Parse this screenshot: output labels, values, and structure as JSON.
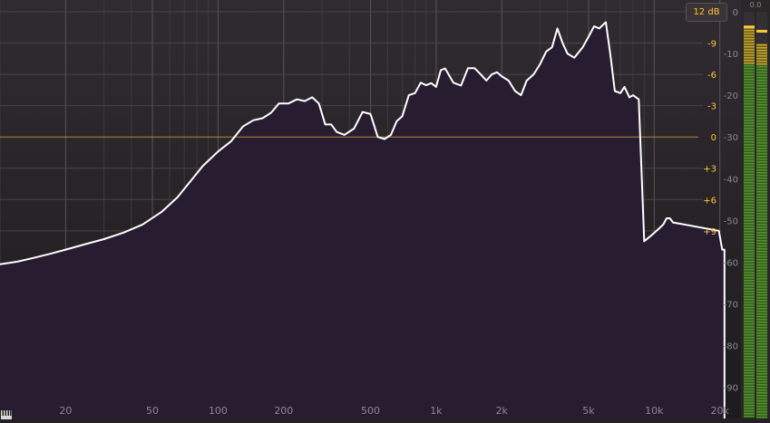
{
  "range_button": {
    "label": "12 dB"
  },
  "meter": {
    "peak_readout": "0.0",
    "left_level_db": -3.5,
    "right_level_db": -7.5,
    "left_peak_db": -3.2,
    "right_peak_db": -4.2
  },
  "colors": {
    "background": "#2a262a",
    "fill_top": "#6a2c86",
    "fill_bottom": "#281c30",
    "curve": "#ffffff",
    "zero_line": "#c8a03c",
    "eq_label": "#ffc53b",
    "db_label": "#8c8a8c",
    "meter_green": "#4c9a20",
    "meter_yellow": "#c8a81e",
    "meter_peak": "#ffc53b"
  },
  "chart_data": {
    "type": "area",
    "title": "",
    "xlabel": "",
    "ylabel": "",
    "x_scale": "log",
    "xlim": [
      10,
      25000
    ],
    "ylim": [
      -94,
      0
    ],
    "grid": true,
    "freq_labels": [
      {
        "f": 20,
        "label": "20"
      },
      {
        "f": 50,
        "label": "50"
      },
      {
        "f": 100,
        "label": "100"
      },
      {
        "f": 200,
        "label": "200"
      },
      {
        "f": 500,
        "label": "500"
      },
      {
        "f": 1000,
        "label": "1k"
      },
      {
        "f": 2000,
        "label": "2k"
      },
      {
        "f": 5000,
        "label": "5k"
      },
      {
        "f": 10000,
        "label": "10k"
      },
      {
        "f": 20000,
        "label": "20k"
      }
    ],
    "db_labels": [
      {
        "db": 0,
        "label": "0"
      },
      {
        "db": -10,
        "label": "-10"
      },
      {
        "db": -20,
        "label": "-20"
      },
      {
        "db": -30,
        "label": "-30"
      },
      {
        "db": -40,
        "label": "-40"
      },
      {
        "db": -50,
        "label": "-50"
      },
      {
        "db": -60,
        "label": "-60"
      },
      {
        "db": -70,
        "label": "-70"
      },
      {
        "db": -80,
        "label": "-80"
      },
      {
        "db": -90,
        "label": "-90"
      }
    ],
    "eq_scale": {
      "range_db": 12,
      "labels": [
        {
          "db": 9,
          "label": "+9"
        },
        {
          "db": 6,
          "label": "+6"
        },
        {
          "db": 3,
          "label": "+3"
        },
        {
          "db": 0,
          "label": "0"
        },
        {
          "db": -3,
          "label": "-3"
        },
        {
          "db": -6,
          "label": "-6"
        },
        {
          "db": -9,
          "label": "-9"
        },
        {
          "db": -12,
          "label": "-12"
        }
      ]
    },
    "series": [
      {
        "x": [
          10,
          12,
          14,
          17,
          20,
          25,
          30,
          37,
          45,
          55,
          65,
          75,
          85,
          100,
          115,
          130,
          145,
          160,
          175,
          190,
          210,
          230,
          250,
          270,
          290,
          310,
          330,
          350,
          380,
          420,
          460,
          500,
          540,
          580,
          620,
          660,
          700,
          750,
          800,
          850,
          900,
          950,
          1000,
          1050,
          1100,
          1200,
          1300,
          1400,
          1500,
          1600,
          1700,
          1800,
          1900,
          2000,
          2150,
          2300,
          2450,
          2600,
          2800,
          3000,
          3200,
          3400,
          3600,
          3800,
          4000,
          4300,
          4700,
          5000,
          5300,
          5600,
          6000,
          6300,
          6600,
          7000,
          7300,
          7700,
          8000,
          8500,
          9000,
          9500,
          10000,
          10500,
          11000,
          11400,
          11800,
          12200,
          19800,
          20500,
          21000
        ],
        "y": [
          -60.5,
          -59.9,
          -59.1,
          -58.0,
          -57.0,
          -55.6,
          -54.5,
          -52.9,
          -51.0,
          -48.0,
          -44.5,
          -40.5,
          -37.0,
          -33.5,
          -31.0,
          -27.5,
          -26.0,
          -25.5,
          -24.2,
          -22.0,
          -22.0,
          -21.0,
          -21.4,
          -20.5,
          -22.0,
          -27.0,
          -27.0,
          -28.8,
          -29.5,
          -28.0,
          -24.0,
          -24.5,
          -30.0,
          -30.5,
          -29.5,
          -26.2,
          -25.0,
          -20.0,
          -19.5,
          -17.0,
          -17.6,
          -17.1,
          -18.0,
          -14.0,
          -13.6,
          -17.0,
          -17.7,
          -13.5,
          -13.5,
          -15.0,
          -16.5,
          -15.0,
          -14.5,
          -15.5,
          -16.5,
          -19.0,
          -20.0,
          -16.5,
          -15.0,
          -12.5,
          -9.5,
          -8.5,
          -4.0,
          -7.5,
          -10.0,
          -11.0,
          -8.5,
          -6.0,
          -3.5,
          -4.0,
          -2.5,
          -10.5,
          -19.0,
          -19.5,
          -18.0,
          -20.5,
          -20.0,
          -21.0,
          -55.0,
          -54.0,
          -53.0,
          -52.0,
          -51.0,
          -49.5,
          -49.5,
          -50.5,
          -52.5,
          -57.0,
          -57.0
        ]
      }
    ]
  }
}
